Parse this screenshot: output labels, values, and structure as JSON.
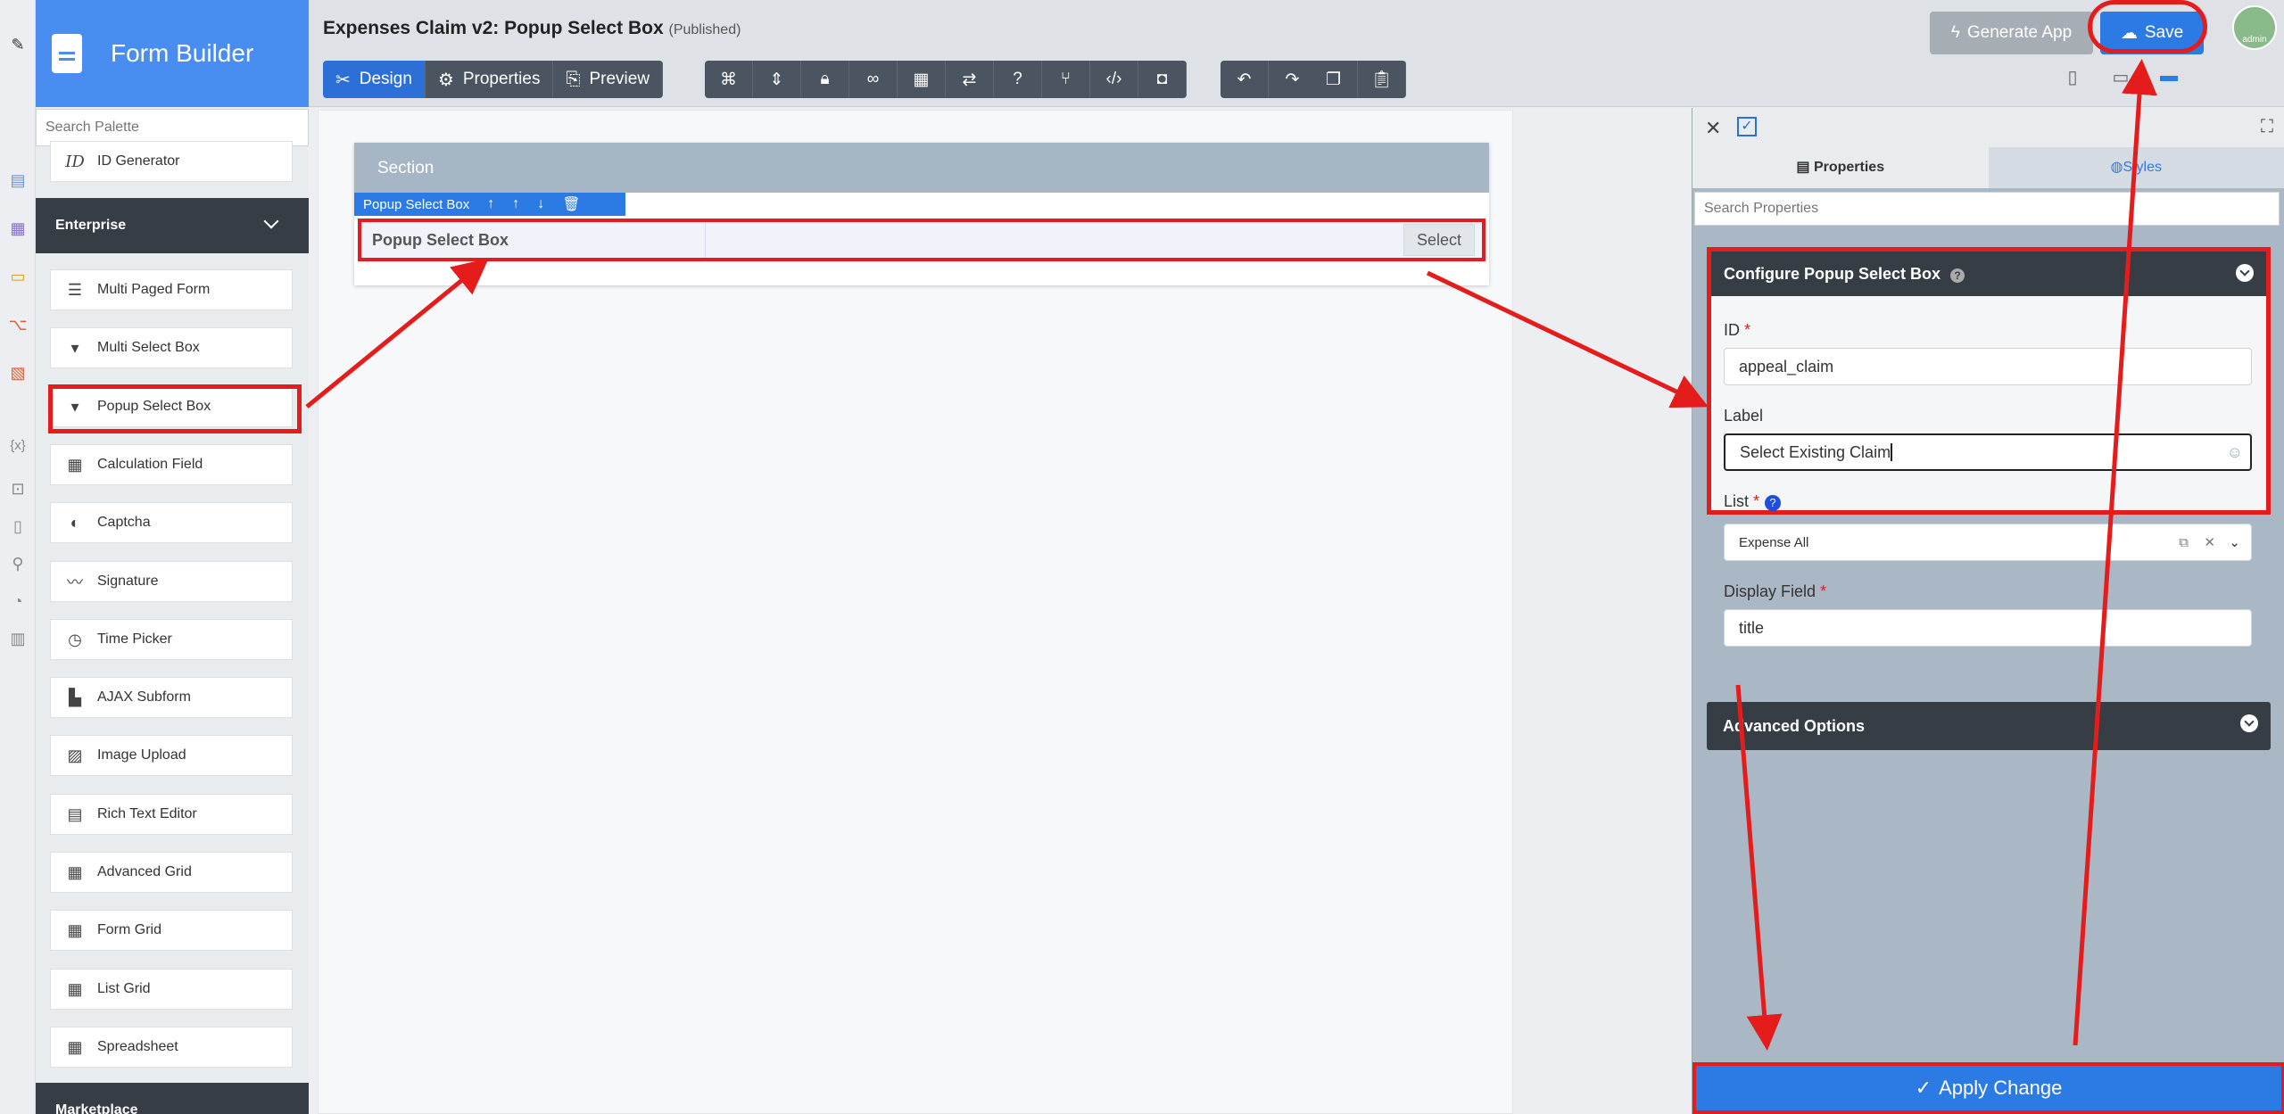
{
  "app": {
    "title": "Form Builder"
  },
  "palette": {
    "search_placeholder": "Search Palette",
    "first_item": "ID Generator",
    "category": "Enterprise",
    "items": [
      {
        "label": "Multi Paged Form",
        "icon": "form-pages-icon"
      },
      {
        "label": "Multi Select Box",
        "icon": "dropdown-icon"
      },
      {
        "label": "Popup Select Box",
        "icon": "dropdown-icon"
      },
      {
        "label": "Calculation Field",
        "icon": "calculator-icon"
      },
      {
        "label": "Captcha",
        "icon": "shield-icon"
      },
      {
        "label": "Signature",
        "icon": "signature-icon"
      },
      {
        "label": "Time Picker",
        "icon": "clock-icon"
      },
      {
        "label": "AJAX Subform",
        "icon": "file-icon"
      },
      {
        "label": "Image Upload",
        "icon": "image-icon"
      },
      {
        "label": "Rich Text Editor",
        "icon": "editor-icon"
      },
      {
        "label": "Advanced Grid",
        "icon": "table-icon"
      },
      {
        "label": "Form Grid",
        "icon": "table-icon"
      },
      {
        "label": "List Grid",
        "icon": "table-icon"
      },
      {
        "label": "Spreadsheet",
        "icon": "table-icon"
      }
    ],
    "next_category": "Marketplace"
  },
  "header": {
    "form_title": "Expenses Claim v2: Popup Select Box",
    "status": "(Published)",
    "tabs": [
      "Design",
      "Properties",
      "Preview"
    ],
    "generate_label": "Generate App",
    "save_label": "Save",
    "avatar_label": "admin"
  },
  "canvas": {
    "section_title": "Section",
    "toolbar_label": "Popup Select Box",
    "field_label": "Popup Select Box",
    "select_label": "Select"
  },
  "properties": {
    "tab_properties": "Properties",
    "tab_styles": "Styles",
    "search_placeholder": "Search Properties",
    "panel_title": "Configure Popup Select Box",
    "id_label": "ID",
    "id_value": "appeal_claim",
    "label_label": "Label",
    "label_value": "Select Existing Claim",
    "list_label": "List",
    "list_value": "Expense All",
    "display_label": "Display Field",
    "display_value": "title",
    "advanced_label": "Advanced Options",
    "apply_label": "Apply Change"
  },
  "colors": {
    "accent": "#2c7be5",
    "highlight": "#e41c1c",
    "dark": "#363d45"
  }
}
